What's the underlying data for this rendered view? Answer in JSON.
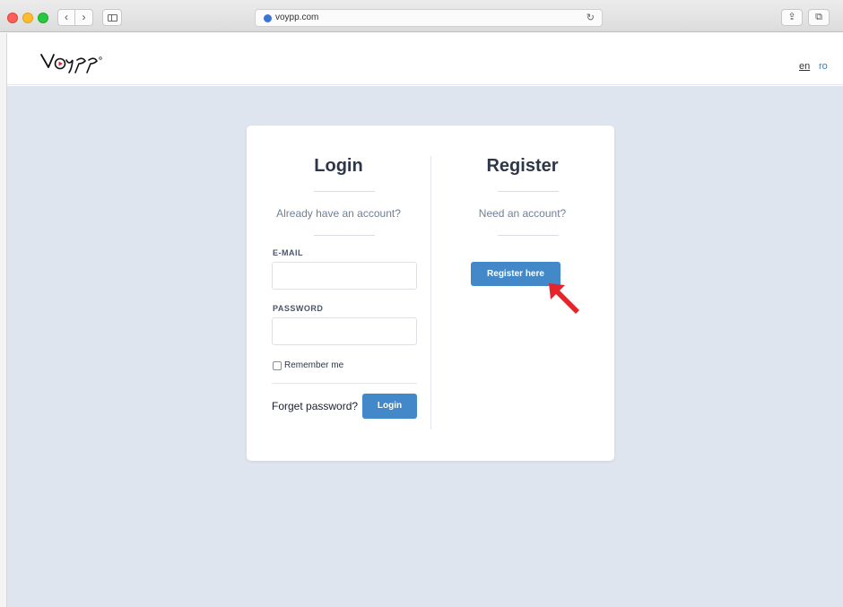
{
  "browser": {
    "url": "voypp.com",
    "icons": {
      "back": "chevron-left-icon",
      "forward": "chevron-right-icon",
      "sidebar": "sidebar-icon",
      "reload": "reload-icon",
      "share": "share-icon",
      "tabs": "tabs-icon",
      "site": "globe-icon"
    },
    "glyphs": {
      "back": "‹",
      "forward": "›",
      "reload": "↻",
      "share": "⇪",
      "tabs": "⧉"
    }
  },
  "header": {
    "logo_text": "voypp",
    "languages": [
      "en",
      "ro"
    ]
  },
  "login": {
    "title": "Login",
    "subtitle": "Already have an account?",
    "email_label": "E-MAIL",
    "email_value": "",
    "password_label": "PASSWORD",
    "password_value": "",
    "remember_label": "Remember me",
    "remember_checked": false,
    "forgot_label": "Forget password?",
    "submit_label": "Login"
  },
  "register": {
    "title": "Register",
    "subtitle": "Need an account?",
    "button_label": "Register here"
  },
  "colors": {
    "accent": "#4388c8",
    "page_background": "#dfe5ee",
    "heading": "#2d3748",
    "pointer_arrow": "#e8242a"
  }
}
